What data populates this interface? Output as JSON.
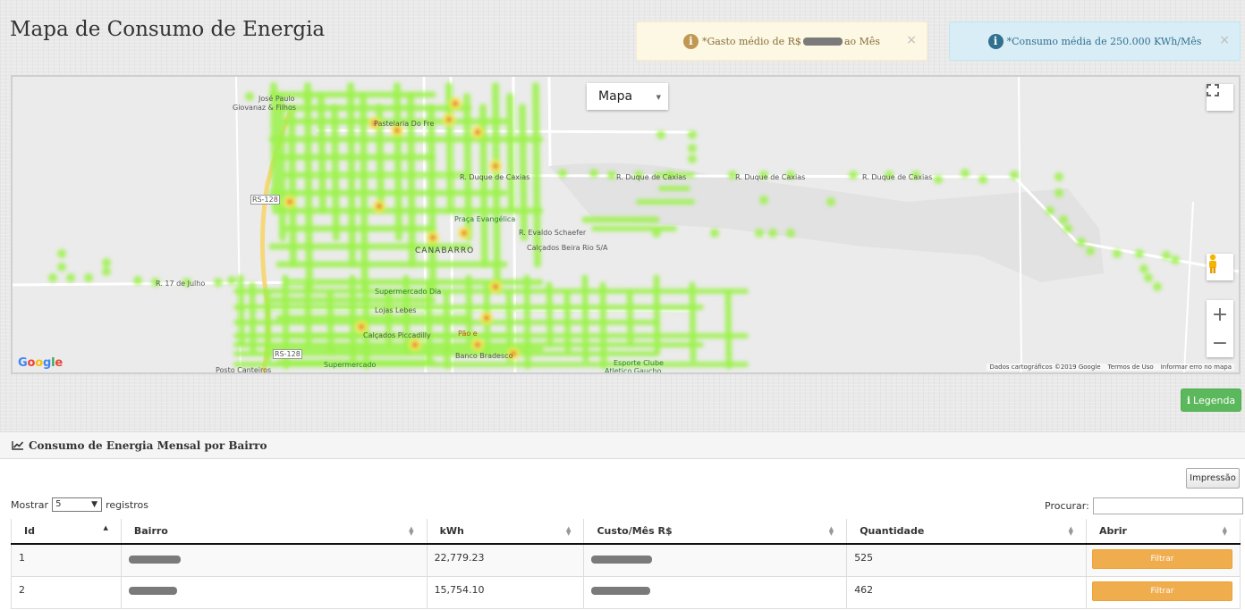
{
  "page": {
    "title": "Mapa de Consumo de Energia"
  },
  "alerts": {
    "gasto": {
      "prefix": "*Gasto médio de R$",
      "suffix": "ao Mês"
    },
    "consumo": {
      "text": "*Consumo média de 250.000 KWh/Mês"
    }
  },
  "map": {
    "type_select": "Mapa",
    "logo": "Google",
    "footer": [
      "Dados cartográficos ©2019 Google",
      "Termos de Uso",
      "Informar erro no mapa"
    ],
    "labels": {
      "jose_paulo": "José Paulo",
      "giovanaz": "Giovanaz & Filhos",
      "pastelaria": "Pastelaria Do Fre",
      "praca": "Praça Evangélica",
      "canabarro": "CANABARRO",
      "calcados": "Calçados Beira Rio S/A",
      "supermercado_dia": "Supermercado Dia",
      "lojas_lebes": "Lojas Lebes",
      "calcados_piccadilly": "Calçados Piccadilly",
      "pao": "Pão e",
      "banco": "Banco Bradesco",
      "posto": "Posto Canteiros",
      "supermercado": "Supermercado",
      "esporte": "Esporte Clube",
      "atletico": "Atletico Gaucho",
      "duque1": "R. Duque de Caxias",
      "duque2": "R. Duque de Caxias",
      "duque3": "R. Duque de Caxias",
      "duque4": "R. Duque de Caxias",
      "rua17": "R. 17 de Julho",
      "rs128a": "RS-128",
      "rs128b": "RS-128",
      "evaldo": "R. Evaldo Schaefer"
    }
  },
  "legend_button": "Legenda",
  "panel": {
    "title": "Consumo de Energia Mensal por Bairro",
    "print": "Impressão",
    "show_label": "Mostrar",
    "show_value": "5",
    "records_label": "registros",
    "search_label": "Procurar:",
    "columns": [
      "Id",
      "Bairro",
      "kWh",
      "Custo/Mês R$",
      "Quantidade",
      "Abrir"
    ],
    "rows": [
      {
        "id": "1",
        "kwh": "22,779.23",
        "quantidade": "525",
        "action": "Filtrar"
      },
      {
        "id": "2",
        "kwh": "15,754.10",
        "quantidade": "462",
        "action": "Filtrar"
      }
    ]
  }
}
